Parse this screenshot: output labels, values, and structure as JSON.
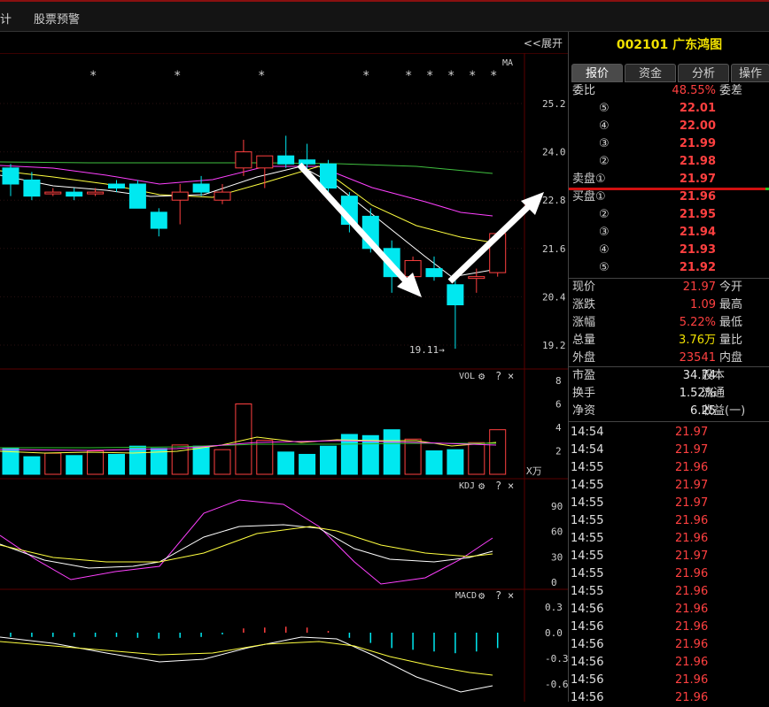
{
  "top_bar": {
    "left_fragment": "计",
    "alert": "股票预警"
  },
  "chart": {
    "expand_label": "<<展开",
    "ma_label": "MA",
    "price_ticks": [
      "25.2",
      "24.0",
      "22.8",
      "21.6",
      "20.4",
      "19.2"
    ],
    "low_annotation": "19.11→",
    "vol_label": "VOL",
    "vol_ticks": [
      "8",
      "6",
      "4",
      "2"
    ],
    "vol_unit": "X万",
    "kdj_label": "KDJ",
    "kdj_ticks": [
      "90",
      "60",
      "30",
      "0"
    ],
    "macd_label": "MACD",
    "macd_ticks": [
      "0.3",
      "0.0",
      "-0.3",
      "-0.6"
    ],
    "question": "?",
    "close": "×"
  },
  "chart_data": {
    "type": "candlestick",
    "price_axis": [
      19.2,
      25.2
    ],
    "candles": [
      {
        "o": 23.6,
        "h": 23.7,
        "l": 22.9,
        "c": 23.2
      },
      {
        "o": 23.3,
        "h": 23.5,
        "l": 22.8,
        "c": 22.9
      },
      {
        "o": 23.0,
        "h": 23.1,
        "l": 22.9,
        "c": 23.0
      },
      {
        "o": 23.0,
        "h": 23.1,
        "l": 22.8,
        "c": 22.9
      },
      {
        "o": 23.0,
        "h": 23.1,
        "l": 22.9,
        "c": 23.0
      },
      {
        "o": 23.2,
        "h": 23.3,
        "l": 23.0,
        "c": 23.1
      },
      {
        "o": 23.2,
        "h": 23.3,
        "l": 22.7,
        "c": 22.6
      },
      {
        "o": 22.5,
        "h": 22.6,
        "l": 21.9,
        "c": 22.1
      },
      {
        "o": 22.8,
        "h": 23.2,
        "l": 22.2,
        "c": 23.0
      },
      {
        "o": 23.2,
        "h": 23.4,
        "l": 22.9,
        "c": 23.0
      },
      {
        "o": 22.8,
        "h": 23.2,
        "l": 22.7,
        "c": 23.0
      },
      {
        "o": 23.6,
        "h": 24.3,
        "l": 23.4,
        "c": 24.0
      },
      {
        "o": 23.6,
        "h": 23.9,
        "l": 23.1,
        "c": 23.9
      },
      {
        "o": 23.9,
        "h": 24.4,
        "l": 23.6,
        "c": 23.7
      },
      {
        "o": 23.8,
        "h": 24.2,
        "l": 23.5,
        "c": 23.7
      },
      {
        "o": 23.7,
        "h": 23.8,
        "l": 22.8,
        "c": 23.1
      },
      {
        "o": 22.9,
        "h": 23.0,
        "l": 22.0,
        "c": 22.2
      },
      {
        "o": 22.4,
        "h": 22.6,
        "l": 21.5,
        "c": 21.6
      },
      {
        "o": 21.6,
        "h": 21.8,
        "l": 20.5,
        "c": 20.9
      },
      {
        "o": 20.9,
        "h": 21.4,
        "l": 20.6,
        "c": 21.3
      },
      {
        "o": 21.1,
        "h": 21.4,
        "l": 20.8,
        "c": 20.9
      },
      {
        "o": 20.7,
        "h": 20.9,
        "l": 19.11,
        "c": 20.2
      },
      {
        "o": 20.9,
        "h": 21.1,
        "l": 20.5,
        "c": 20.9
      },
      {
        "o": 21.0,
        "h": 22.0,
        "l": 20.9,
        "c": 21.97
      }
    ],
    "volume": [
      2.2,
      1.5,
      1.8,
      1.6,
      2.0,
      1.7,
      2.4,
      2.2,
      2.5,
      2.4,
      2.1,
      6.0,
      2.9,
      1.9,
      1.7,
      2.4,
      3.4,
      3.3,
      3.8,
      3.0,
      2.0,
      2.1,
      2.7,
      3.8
    ],
    "volume_axis": [
      0,
      8
    ]
  },
  "panel": {
    "code": "002101",
    "name": "广东鸿图",
    "tabs": [
      "报价",
      "资金",
      "分析",
      "操作"
    ],
    "weibi": {
      "label": "委比",
      "value": "48.55%",
      "right": "委差"
    },
    "asks": [
      {
        "n": "⑤",
        "p": "22.01"
      },
      {
        "n": "④",
        "p": "22.00"
      },
      {
        "n": "③",
        "p": "21.99"
      },
      {
        "n": "②",
        "p": "21.98"
      },
      {
        "n": "卖盘①",
        "p": "21.97"
      }
    ],
    "bids": [
      {
        "n": "买盘①",
        "p": "21.96"
      },
      {
        "n": "②",
        "p": "21.95"
      },
      {
        "n": "③",
        "p": "21.94"
      },
      {
        "n": "④",
        "p": "21.93"
      },
      {
        "n": "⑤",
        "p": "21.92"
      }
    ],
    "quote": [
      {
        "l": "现价",
        "v": "21.97",
        "r": "今开",
        "c": "red"
      },
      {
        "l": "涨跌",
        "v": "1.09",
        "r": "最高",
        "c": "red"
      },
      {
        "l": "涨幅",
        "v": "5.22%",
        "r": "最低",
        "c": "red"
      },
      {
        "l": "总量",
        "v": "3.76万",
        "r": "量比",
        "c": "yellow"
      },
      {
        "l": "外盘",
        "v": "23541",
        "r": "内盘",
        "c": "red"
      }
    ],
    "stats": [
      {
        "l": "市盈",
        "v": "34.74",
        "r": "股本"
      },
      {
        "l": "换手",
        "v": "1.52%",
        "r": "流通"
      },
      {
        "l": "净资",
        "v": "6.25",
        "r": "收益(一)"
      }
    ],
    "ticks": [
      {
        "t": "14:54",
        "p": "21.97"
      },
      {
        "t": "14:54",
        "p": "21.97"
      },
      {
        "t": "14:55",
        "p": "21.96"
      },
      {
        "t": "14:55",
        "p": "21.97"
      },
      {
        "t": "14:55",
        "p": "21.97"
      },
      {
        "t": "14:55",
        "p": "21.96"
      },
      {
        "t": "14:55",
        "p": "21.96"
      },
      {
        "t": "14:55",
        "p": "21.97"
      },
      {
        "t": "14:55",
        "p": "21.96"
      },
      {
        "t": "14:55",
        "p": "21.96"
      },
      {
        "t": "14:56",
        "p": "21.96"
      },
      {
        "t": "14:56",
        "p": "21.96"
      },
      {
        "t": "14:56",
        "p": "21.96"
      },
      {
        "t": "14:56",
        "p": "21.96"
      },
      {
        "t": "14:56",
        "p": "21.96"
      },
      {
        "t": "14:56",
        "p": "21.96"
      }
    ]
  }
}
